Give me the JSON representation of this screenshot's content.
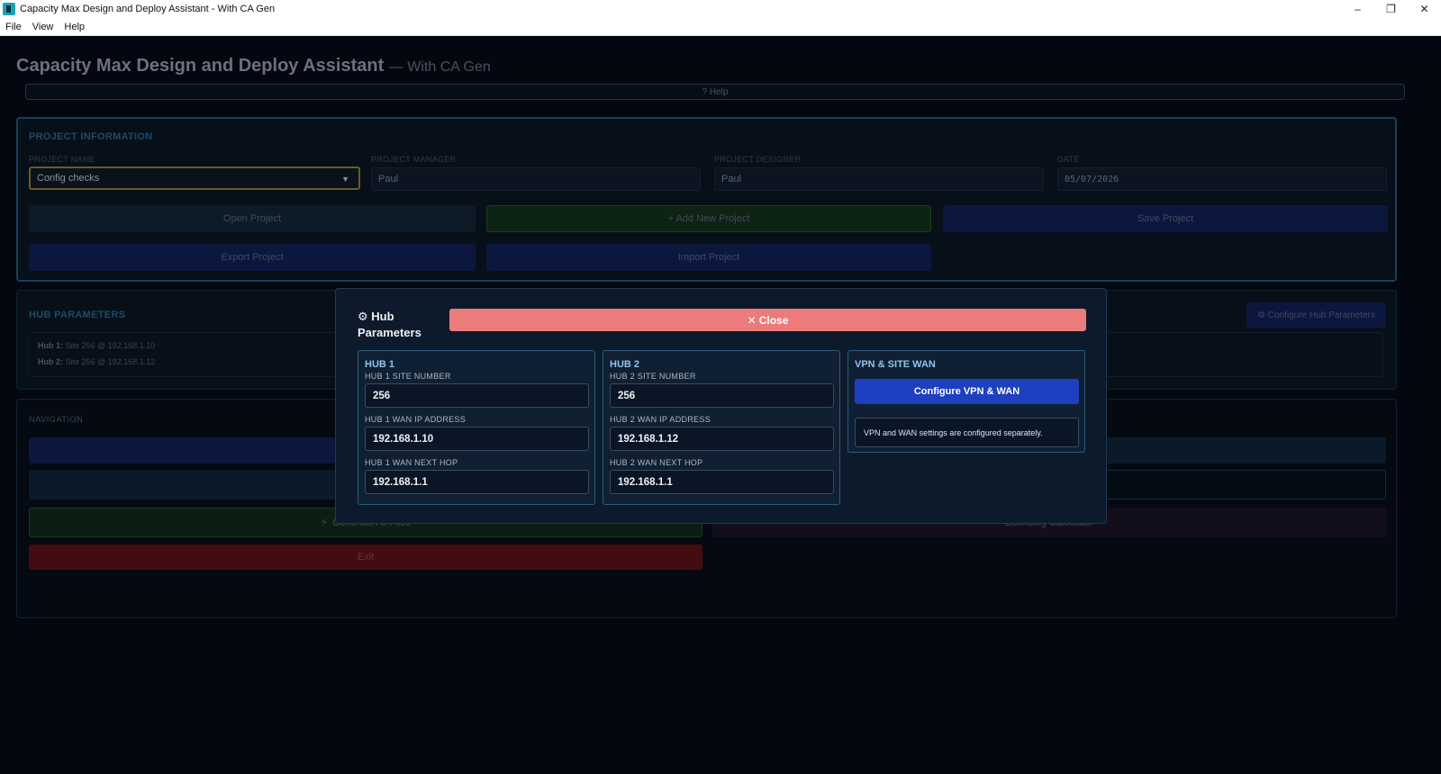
{
  "window": {
    "title": "Capacity Max Design and Deploy Assistant - With CA Gen",
    "minimize": "–",
    "restore": "❐",
    "close": "✕"
  },
  "menu": [
    "File",
    "View",
    "Help"
  ],
  "app": {
    "title": "Capacity Max Design and Deploy Assistant",
    "subtitle": "— With CA Gen",
    "help": "? Help"
  },
  "project": {
    "section_title": "PROJECT INFORMATION",
    "name_label": "PROJECT NAME",
    "name_value": "Config checks",
    "manager_label": "PROJECT MANAGER",
    "manager_value": "Paul",
    "designer_label": "PROJECT DESIGNER",
    "designer_value": "Paul",
    "date_label": "DATE",
    "date_value": "05/07/2026",
    "buttons": {
      "open": "Open Project",
      "add": "+ Add New Project",
      "save": "Save Project",
      "export": "Export Project",
      "import": "Import Project"
    }
  },
  "hub_params": {
    "section_title": "HUB PARAMETERS",
    "configure_button": "⚙ Configure Hub Parameters",
    "hub1_label": "Hub 1:",
    "hub1_value": "Site 256 @ 192.168.1.10",
    "hub2_label": "Hub 2:",
    "hub2_value": "Site 256 @ 192.168.1.12"
  },
  "navigation": {
    "section_title": "NAVIGATION",
    "nav1_partial": "Op",
    "nav2_partial": ")",
    "nav4_partial": "y",
    "generate": "Generate All Files",
    "licensing": "Licensing Calculator",
    "exit": "Exit"
  },
  "modal": {
    "title_line1": "⚙ Hub",
    "title_line2": "Parameters",
    "close": "Close",
    "hub1": {
      "title": "HUB 1",
      "site_label": "HUB 1 SITE NUMBER",
      "site_value": "256",
      "ip_label": "HUB 1 WAN IP ADDRESS",
      "ip_value": "192.168.1.10",
      "hop_label": "HUB 1 WAN NEXT HOP",
      "hop_value": "192.168.1.1"
    },
    "hub2": {
      "title": "HUB 2",
      "site_label": "HUB 2 SITE NUMBER",
      "site_value": "256",
      "ip_label": "HUB 2 WAN IP ADDRESS",
      "ip_value": "192.168.1.12",
      "hop_label": "HUB 2 WAN NEXT HOP",
      "hop_value": "192.168.1.1"
    },
    "vpn": {
      "title": "VPN & SITE WAN",
      "button": "Configure VPN & WAN",
      "note": "VPN and WAN settings are configured separately."
    }
  }
}
